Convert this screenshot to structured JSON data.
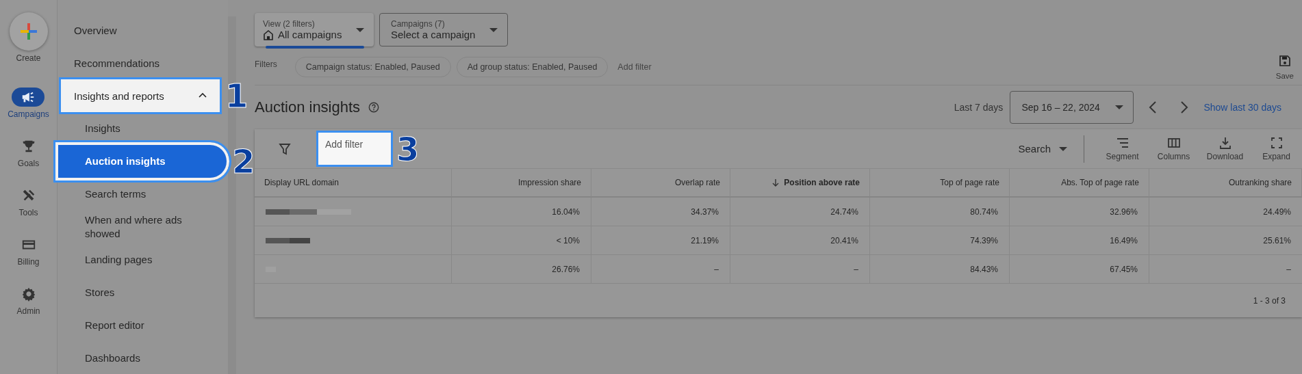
{
  "rail": [
    {
      "label": "Create",
      "kind": "create",
      "selected": false
    },
    {
      "label": "Campaigns",
      "kind": "campaigns",
      "selected": true
    },
    {
      "label": "Goals",
      "kind": "goals",
      "selected": false
    },
    {
      "label": "Tools",
      "kind": "tools",
      "selected": false
    },
    {
      "label": "Billing",
      "kind": "billing",
      "selected": false
    },
    {
      "label": "Admin",
      "kind": "admin",
      "selected": false
    }
  ],
  "nav": [
    {
      "label": "Overview",
      "selected": false,
      "highlighted": false
    },
    {
      "label": "Recommendations",
      "selected": false,
      "highlighted": false
    },
    {
      "label": "Insights and reports",
      "selected": false,
      "highlighted": true,
      "callout": "1",
      "expanded": true,
      "children": [
        {
          "label": "Insights",
          "selected": false,
          "highlighted": false
        },
        {
          "label": "Auction insights",
          "selected": true,
          "highlighted": true,
          "callout": "2"
        },
        {
          "label": "Search terms",
          "selected": false,
          "highlighted": false
        },
        {
          "label": "When and where ads showed",
          "selected": false,
          "highlighted": false
        },
        {
          "label": "Landing pages",
          "selected": false,
          "highlighted": false
        },
        {
          "label": "Stores",
          "selected": false,
          "highlighted": false
        },
        {
          "label": "Report editor",
          "selected": false,
          "highlighted": false
        },
        {
          "label": "Dashboards",
          "selected": false,
          "highlighted": false
        }
      ]
    }
  ],
  "selectors": [
    {
      "kind": "view",
      "label": "View (2 filters)",
      "value": "All campaigns"
    },
    {
      "kind": "campaign",
      "label": "Campaigns (7)",
      "value": "Select a campaign"
    }
  ],
  "filters": {
    "label": "Filters",
    "chips": [
      "Campaign status: Enabled, Paused",
      "Ad group status: Enabled, Paused"
    ],
    "add": "Add filter"
  },
  "save": "Save",
  "title": "Auction insights",
  "date": {
    "preset": "Last 7 days",
    "range": "Sep 16 – 22, 2024",
    "link": "Show last 30 days"
  },
  "table": {
    "add_filter": {
      "placeholder": "Add filter",
      "highlighted": true,
      "callout": "3"
    },
    "segment_select": "Search",
    "tools": [
      {
        "kind": "segment",
        "label": "Segment"
      },
      {
        "kind": "columns",
        "label": "Columns"
      },
      {
        "kind": "download",
        "label": "Download"
      },
      {
        "kind": "expand",
        "label": "Expand"
      }
    ],
    "columns": [
      {
        "label": "Display URL domain",
        "sorted": false
      },
      {
        "label": "Impression share",
        "sorted": false
      },
      {
        "label": "Overlap rate",
        "sorted": false
      },
      {
        "label": "Position above rate",
        "sorted": true
      },
      {
        "label": "Top of page rate",
        "sorted": false
      },
      {
        "label": "Abs. Top of page rate",
        "sorted": false
      },
      {
        "label": "Outranking share",
        "sorted": false
      }
    ],
    "rows": [
      {
        "values": [
          "16.04%",
          "34.37%",
          "24.74%",
          "80.74%",
          "32.96%",
          "24.49%"
        ]
      },
      {
        "values": [
          "< 10%",
          "21.19%",
          "20.41%",
          "74.39%",
          "16.49%",
          "25.61%"
        ]
      },
      {
        "values": [
          "26.76%",
          "–",
          "–",
          "84.43%",
          "67.45%",
          "–"
        ]
      }
    ],
    "pagination": "1 - 3 of 3"
  }
}
